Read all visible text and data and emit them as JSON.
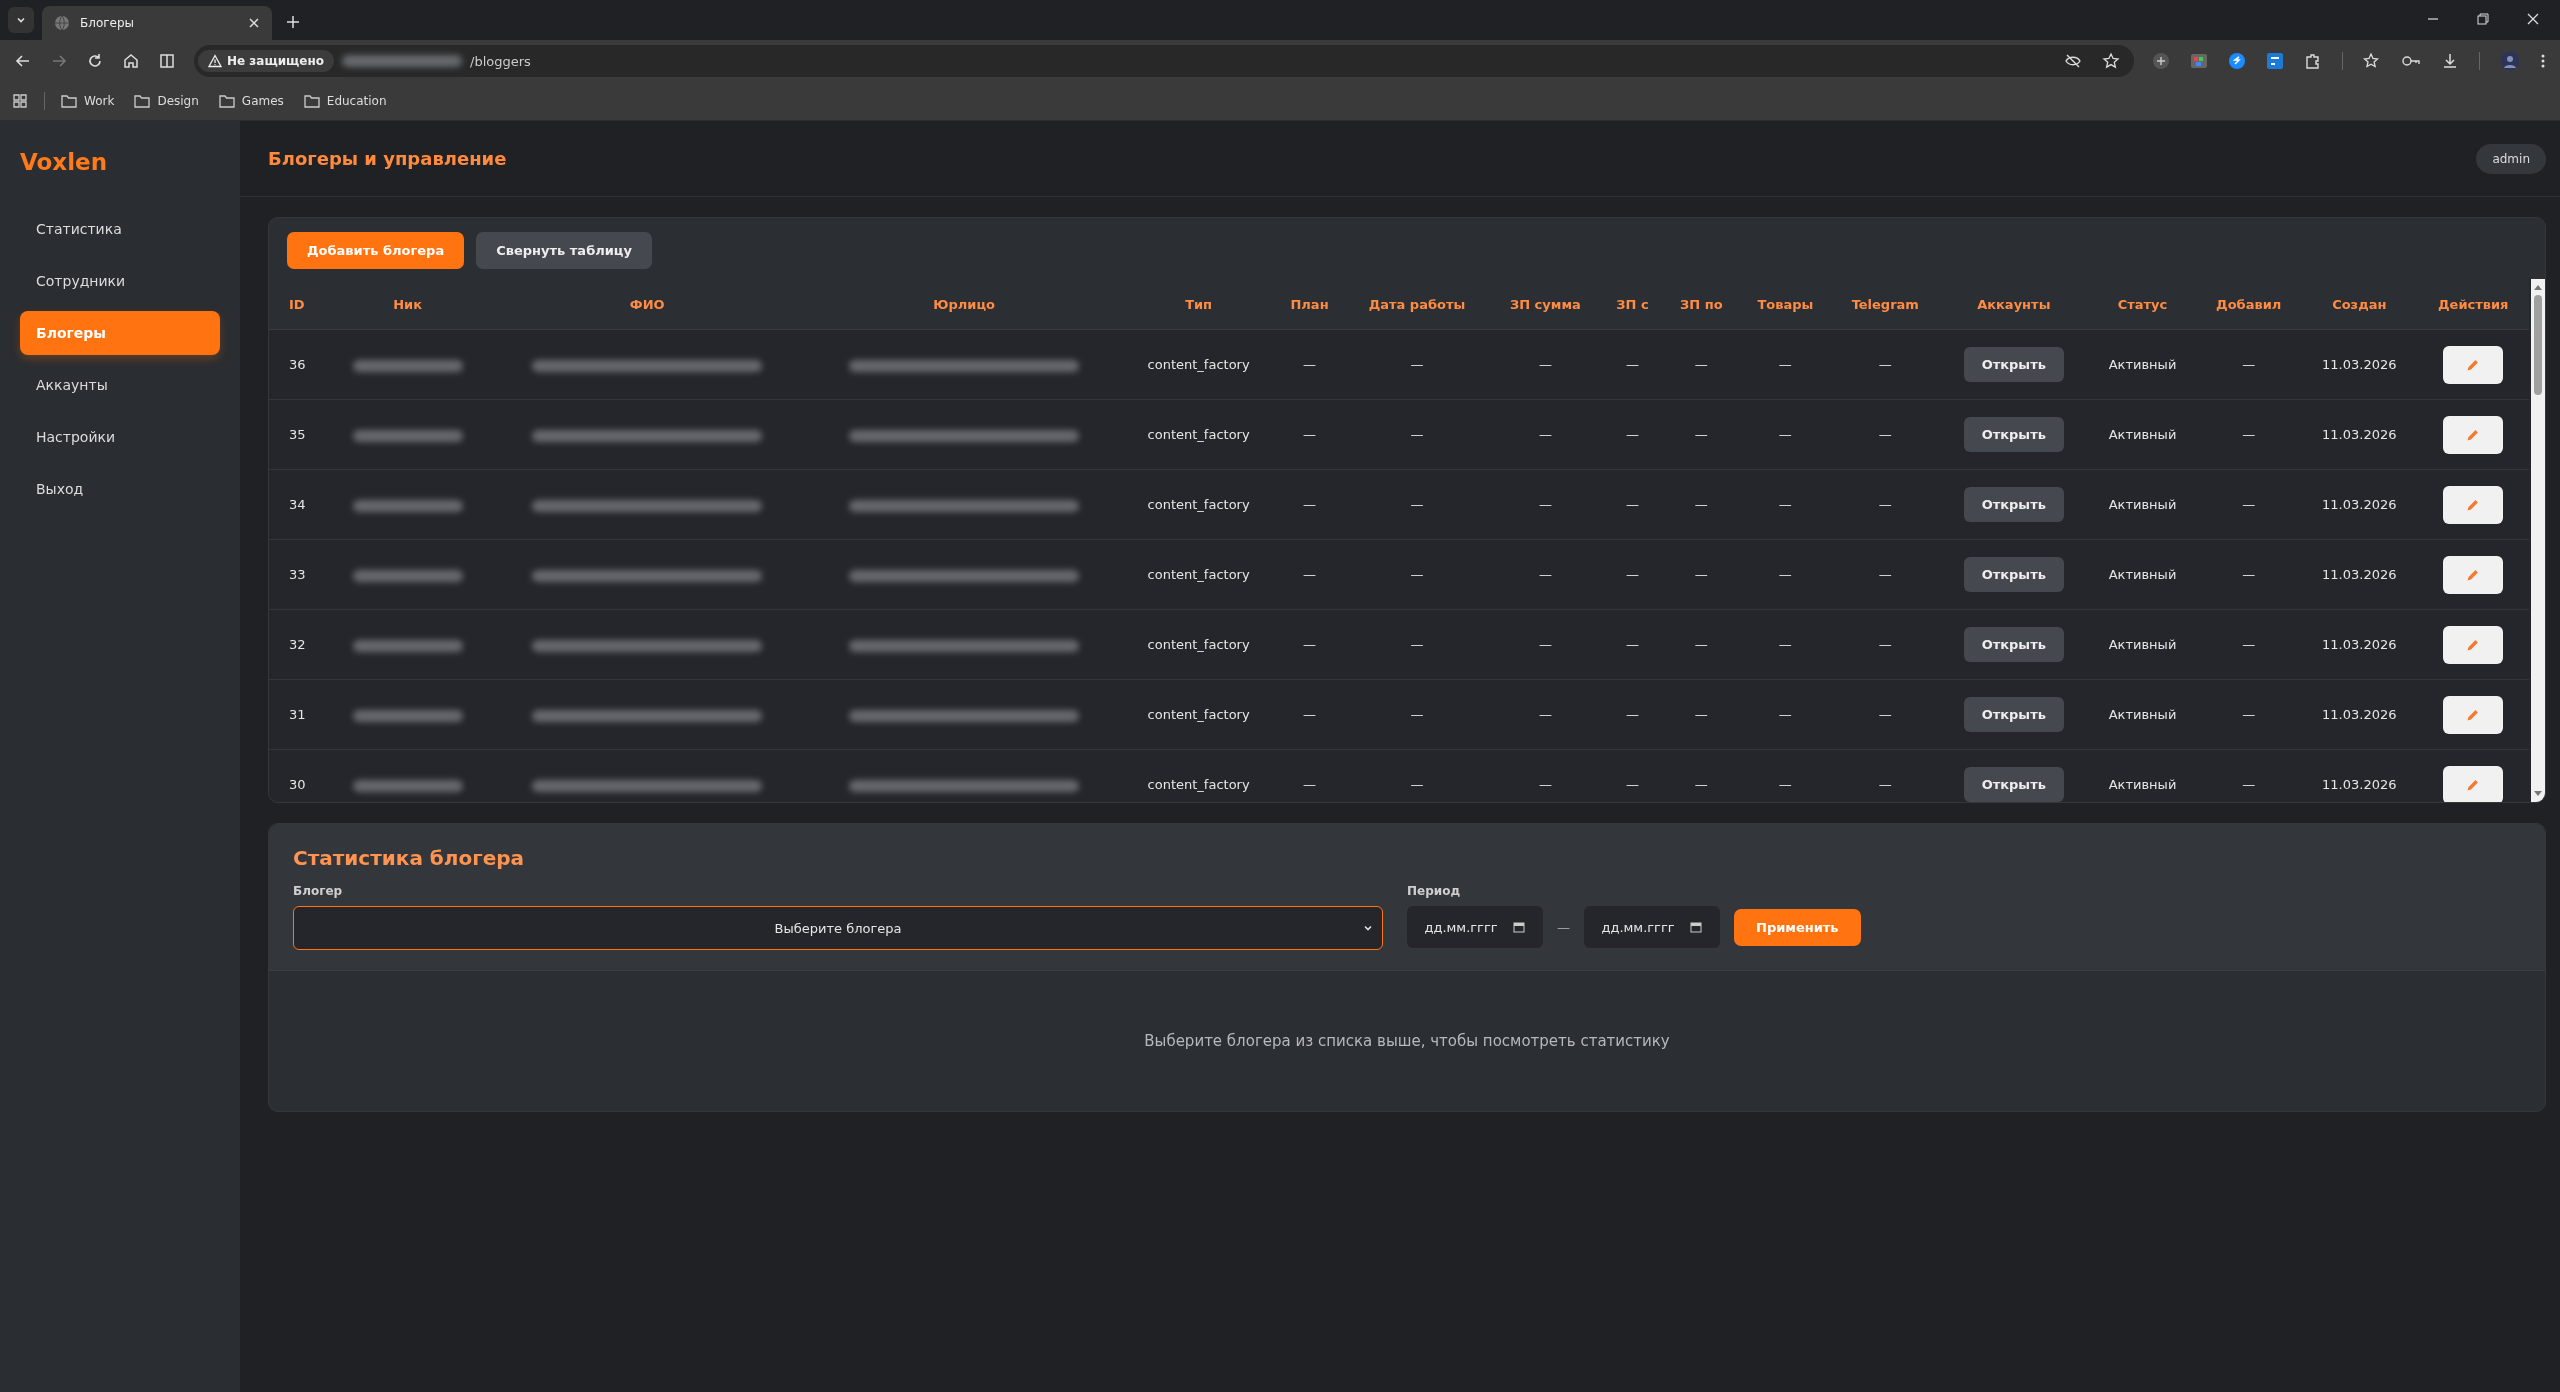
{
  "browser": {
    "tab_title": "Блогеры",
    "security_label": "Не защищено",
    "url_path": "/bloggers",
    "bookmarks": [
      "Work",
      "Design",
      "Games",
      "Education"
    ]
  },
  "sidebar": {
    "logo": "Voxlen",
    "items": [
      {
        "label": "Статистика",
        "selected": false
      },
      {
        "label": "Сотрудники",
        "selected": false
      },
      {
        "label": "Блогеры",
        "selected": true
      },
      {
        "label": "Аккаунты",
        "selected": false
      },
      {
        "label": "Настройки",
        "selected": false
      },
      {
        "label": "Выход",
        "selected": false
      }
    ]
  },
  "header": {
    "title": "Блогеры и управление",
    "user": "admin"
  },
  "toolbar": [
    {
      "label": "Добавить блогера",
      "kind": "primary"
    },
    {
      "label": "Свернуть таблицу",
      "kind": "secondary"
    }
  ],
  "table": {
    "columns": [
      {
        "label": "ID",
        "kind": "text"
      },
      {
        "label": "Ник",
        "kind": "blurred"
      },
      {
        "label": "ФИО",
        "kind": "blurred"
      },
      {
        "label": "Юрлицо",
        "kind": "blurred"
      },
      {
        "label": "Тип",
        "kind": "text"
      },
      {
        "label": "План",
        "kind": "text"
      },
      {
        "label": "Дата работы",
        "kind": "text"
      },
      {
        "label": "ЗП сумма",
        "kind": "text"
      },
      {
        "label": "ЗП с",
        "kind": "text"
      },
      {
        "label": "ЗП по",
        "kind": "text"
      },
      {
        "label": "Товары",
        "kind": "text"
      },
      {
        "label": "Telegram",
        "kind": "text"
      },
      {
        "label": "Аккаунты",
        "kind": "button"
      },
      {
        "label": "Статус",
        "kind": "text"
      },
      {
        "label": "Добавил",
        "kind": "text"
      },
      {
        "label": "Создан",
        "kind": "text"
      },
      {
        "label": "Действия",
        "kind": "edit"
      }
    ],
    "rows": [
      {
        "cells": [
          "36",
          "",
          "",
          "",
          "content_factory",
          "—",
          "—",
          "—",
          "—",
          "—",
          "—",
          "—",
          "Открыть",
          "Активный",
          "—",
          "11.03.2026",
          ""
        ]
      },
      {
        "cells": [
          "35",
          "",
          "",
          "",
          "content_factory",
          "—",
          "—",
          "—",
          "—",
          "—",
          "—",
          "—",
          "Открыть",
          "Активный",
          "—",
          "11.03.2026",
          ""
        ]
      },
      {
        "cells": [
          "34",
          "",
          "",
          "",
          "content_factory",
          "—",
          "—",
          "—",
          "—",
          "—",
          "—",
          "—",
          "Открыть",
          "Активный",
          "—",
          "11.03.2026",
          ""
        ]
      },
      {
        "cells": [
          "33",
          "",
          "",
          "",
          "content_factory",
          "—",
          "—",
          "—",
          "—",
          "—",
          "—",
          "—",
          "Открыть",
          "Активный",
          "—",
          "11.03.2026",
          ""
        ]
      },
      {
        "cells": [
          "32",
          "",
          "",
          "",
          "content_factory",
          "—",
          "—",
          "—",
          "—",
          "—",
          "—",
          "—",
          "Открыть",
          "Активный",
          "—",
          "11.03.2026",
          ""
        ]
      },
      {
        "cells": [
          "31",
          "",
          "",
          "",
          "content_factory",
          "—",
          "—",
          "—",
          "—",
          "—",
          "—",
          "—",
          "Открыть",
          "Активный",
          "—",
          "11.03.2026",
          ""
        ]
      },
      {
        "cells": [
          "30",
          "",
          "",
          "",
          "content_factory",
          "—",
          "—",
          "—",
          "—",
          "—",
          "—",
          "—",
          "Открыть",
          "Активный",
          "—",
          "11.03.2026",
          ""
        ]
      }
    ]
  },
  "stats": {
    "title": "Статистика блогера",
    "blogger_label": "Блогер",
    "blogger_placeholder": "Выберите блогера",
    "period_label": "Период",
    "date_from": "дд.мм.гггг",
    "separator": "—",
    "date_to": "дд.мм.гггг",
    "apply": "Применить",
    "empty_message": "Выберите блогера из списка выше, чтобы посмотреть статистику"
  }
}
